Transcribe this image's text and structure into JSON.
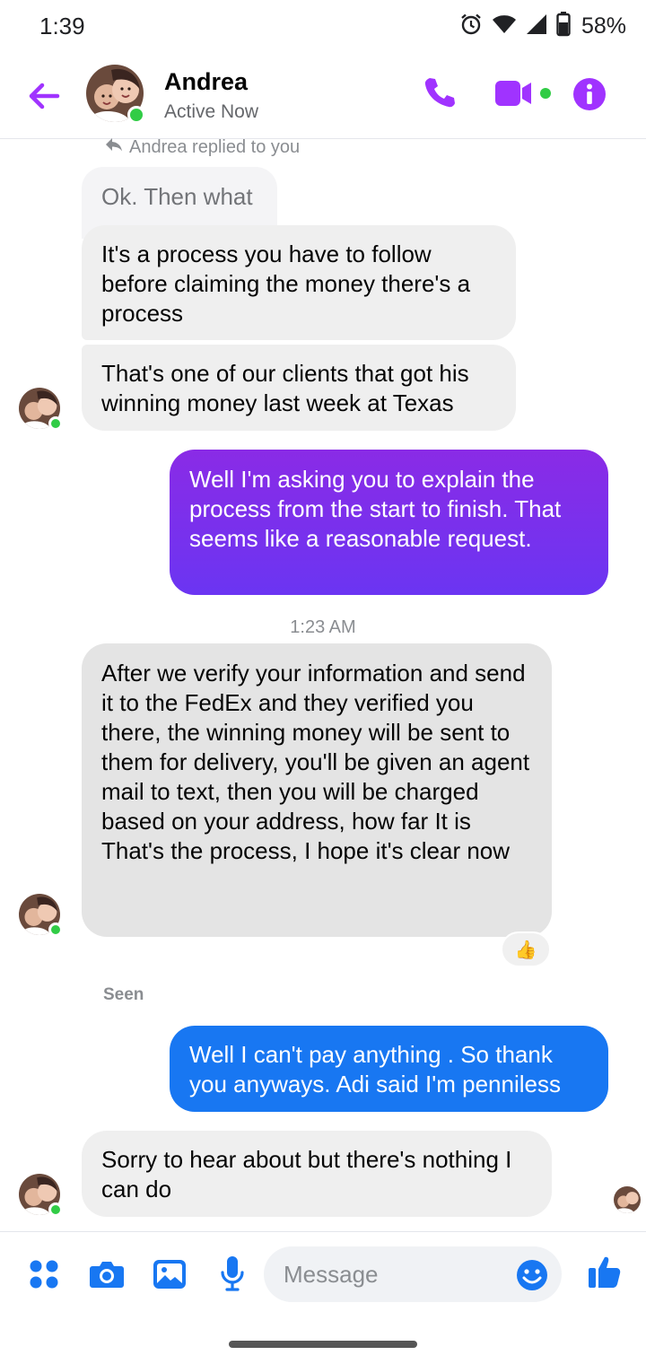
{
  "status_bar": {
    "time": "1:39",
    "battery": "58%"
  },
  "header": {
    "name": "Andrea",
    "status": "Active Now"
  },
  "colors": {
    "accent": "#a033ff",
    "online": "#31cc46",
    "sent_blue": "#1877f2",
    "sent_purple": "#6b35f2"
  },
  "icons": [
    "back-arrow-icon",
    "phone-icon",
    "video-icon",
    "info-icon",
    "alarm-icon",
    "wifi-icon",
    "signal-icon",
    "battery-icon",
    "apps-icon",
    "camera-icon",
    "gallery-icon",
    "mic-icon",
    "emoji-icon",
    "like-icon",
    "reply-icon"
  ],
  "messages": {
    "reply_note": "Andrea replied to you",
    "quoted": "Ok. Then what",
    "m1": "It's a process you have to follow before claiming the money there's a process",
    "m2": "That's one of our clients that got his winning money last week at Texas",
    "m3": "Well I'm asking you to explain the process from the start to finish. That seems like a reasonable request.",
    "timestamp": "1:23 AM",
    "m4": "After we verify your information and send it to the FedEx and they verified you there, the winning money will be sent to them for delivery, you'll be given an agent mail to text, then you will be charged based on your address, how far It is\nThat's the process, I hope it's clear now",
    "reaction": "👍",
    "seen": "Seen",
    "m5": "Well I can't pay anything . So thank you anyways. Adi said I'm penniless",
    "m6": "Sorry to hear about but there's nothing I can do"
  },
  "composer": {
    "placeholder": "Message"
  }
}
